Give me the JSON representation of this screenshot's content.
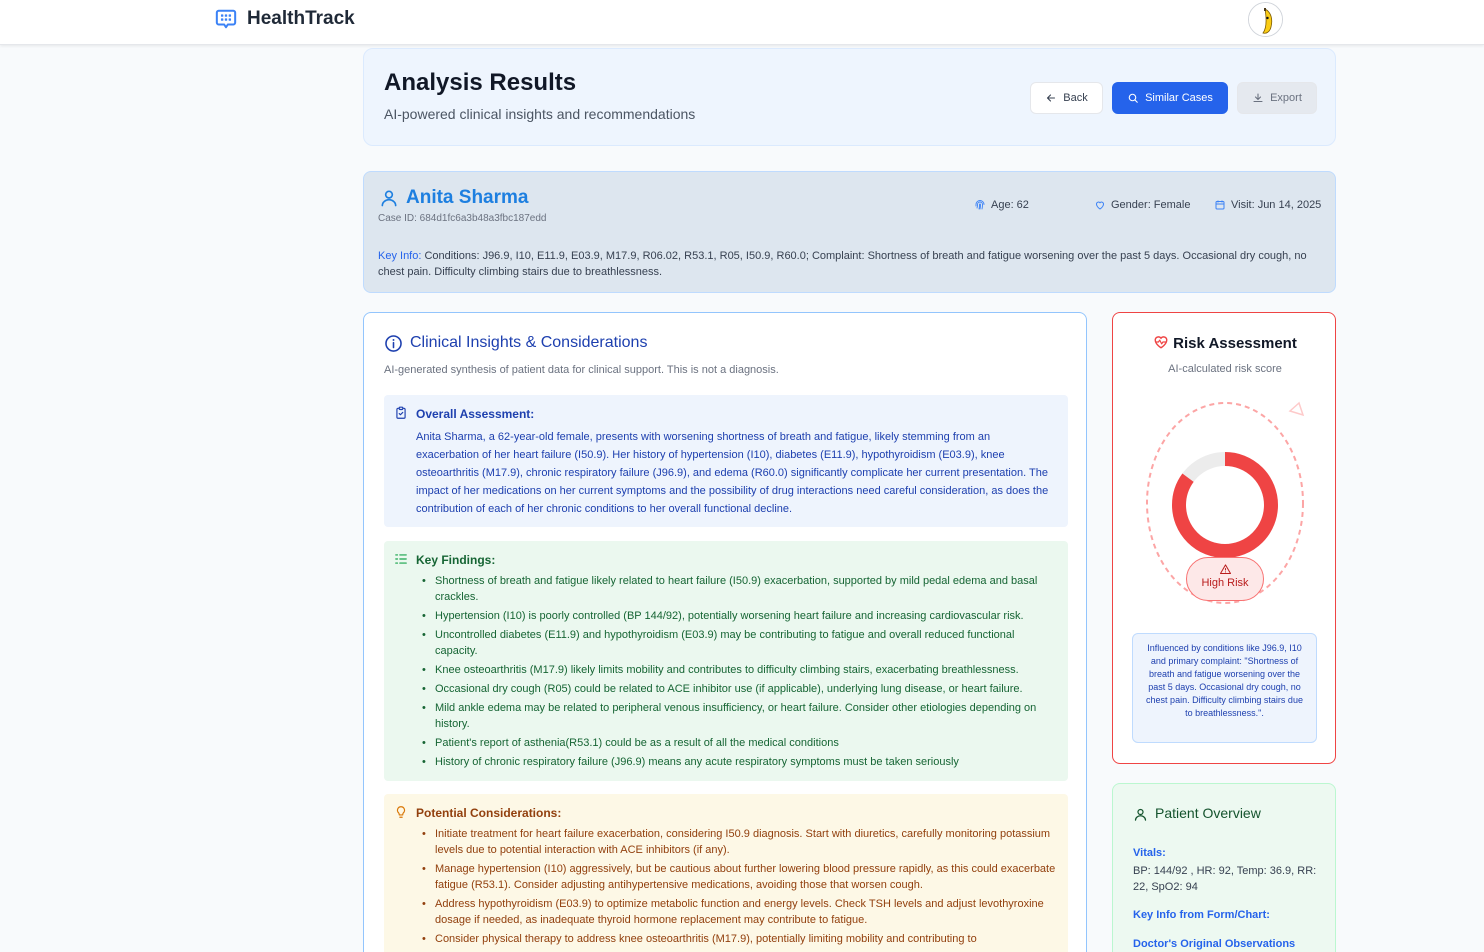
{
  "app": {
    "name": "HealthTrack"
  },
  "header": {
    "title": "Analysis Results",
    "subtitle": "AI-powered clinical insights and recommendations",
    "back_label": "Back",
    "similar_label": "Similar Cases",
    "export_label": "Export"
  },
  "patient": {
    "name": "Anita Sharma",
    "case_id": "Case ID: 684d1fc6a3b48a3fbc187edd",
    "age": "Age: 62",
    "gender": "Gender: Female",
    "visit": "Visit: Jun 14, 2025",
    "key_info_label": "Key Info:",
    "key_info_text": " Conditions: J96.9, I10, E11.9, E03.9, M17.9, R06.02, R53.1, R05, I50.9, R60.0; Complaint: Shortness of breath and fatigue worsening over the past 5 days. Occasional dry cough, no chest pain. Difficulty climbing stairs due to breathlessness."
  },
  "clinical": {
    "title": "Clinical Insights & Considerations",
    "subtitle": "AI-generated synthesis of patient data for clinical support. This is not a diagnosis.",
    "overall": {
      "heading": "Overall Assessment:",
      "text": "Anita Sharma, a 62-year-old female, presents with worsening shortness of breath and fatigue, likely stemming from an exacerbation of her heart failure (I50.9). Her history of hypertension (I10), diabetes (E11.9), hypothyroidism (E03.9), knee osteoarthritis (M17.9), chronic respiratory failure (J96.9), and edema (R60.0) significantly complicate her current presentation. The impact of her medications on her current symptoms and the possibility of drug interactions need careful consideration, as does the contribution of each of her chronic conditions to her overall functional decline."
    },
    "findings": {
      "heading": "Key Findings:",
      "items": [
        "Shortness of breath and fatigue likely related to heart failure (I50.9) exacerbation, supported by mild pedal edema and basal crackles.",
        "Hypertension (I10) is poorly controlled (BP 144/92), potentially worsening heart failure and increasing cardiovascular risk.",
        "Uncontrolled diabetes (E11.9) and hypothyroidism (E03.9) may be contributing to fatigue and overall reduced functional capacity.",
        "Knee osteoarthritis (M17.9) likely limits mobility and contributes to difficulty climbing stairs, exacerbating breathlessness.",
        "Occasional dry cough (R05) could be related to ACE inhibitor use (if applicable), underlying lung disease, or heart failure.",
        "Mild ankle edema may be related to peripheral venous insufficiency, or heart failure. Consider other etiologies depending on history.",
        "Patient's report of asthenia(R53.1) could be as a result of all the medical conditions",
        "History of chronic respiratory failure (J96.9) means any acute respiratory symptoms must be taken seriously"
      ]
    },
    "considerations": {
      "heading": "Potential Considerations:",
      "items": [
        "Initiate treatment for heart failure exacerbation, considering I50.9 diagnosis. Start with diuretics, carefully monitoring potassium levels due to potential interaction with ACE inhibitors (if any).",
        "Manage hypertension (I10) aggressively, but be cautious about further lowering blood pressure rapidly, as this could exacerbate fatigue (R53.1). Consider adjusting antihypertensive medications, avoiding those that worsen cough.",
        "Address hypothyroidism (E03.9) to optimize metabolic function and energy levels. Check TSH levels and adjust levothyroxine dosage if needed, as inadequate thyroid hormone replacement may contribute to fatigue.",
        "Consider physical therapy to address knee osteoarthritis (M17.9), potentially limiting mobility and contributing to"
      ]
    }
  },
  "risk": {
    "title": "Risk Assessment",
    "subtitle": "AI-calculated risk score",
    "level": "High Risk",
    "score_fraction": 0.85,
    "color": "#ef4444",
    "note": "Influenced by conditions like J96.9, I10 and primary complaint: \"Shortness of breath and fatigue worsening over the past 5 days. Occasional dry cough, no chest pain. Difficulty climbing stairs due to breathlessness.\"."
  },
  "overview": {
    "title": "Patient Overview",
    "vitals_label": "Vitals:",
    "vitals": "BP: 144/92 , HR: 92, Temp: 36.9, RR: 22, SpO2: 94",
    "key_info_label": "Key Info from Form/Chart:",
    "doctor_label": "Doctor's Original Observations"
  },
  "icons": [
    "chat-logo-icon",
    "user-icon",
    "fingerprint-icon",
    "heart-icon",
    "calendar-icon",
    "info-icon",
    "clipboard-check-icon",
    "list-icon",
    "lightbulb-icon",
    "heart-pulse-icon",
    "warning-icon",
    "arrow-left-icon",
    "search-icon",
    "download-icon"
  ]
}
